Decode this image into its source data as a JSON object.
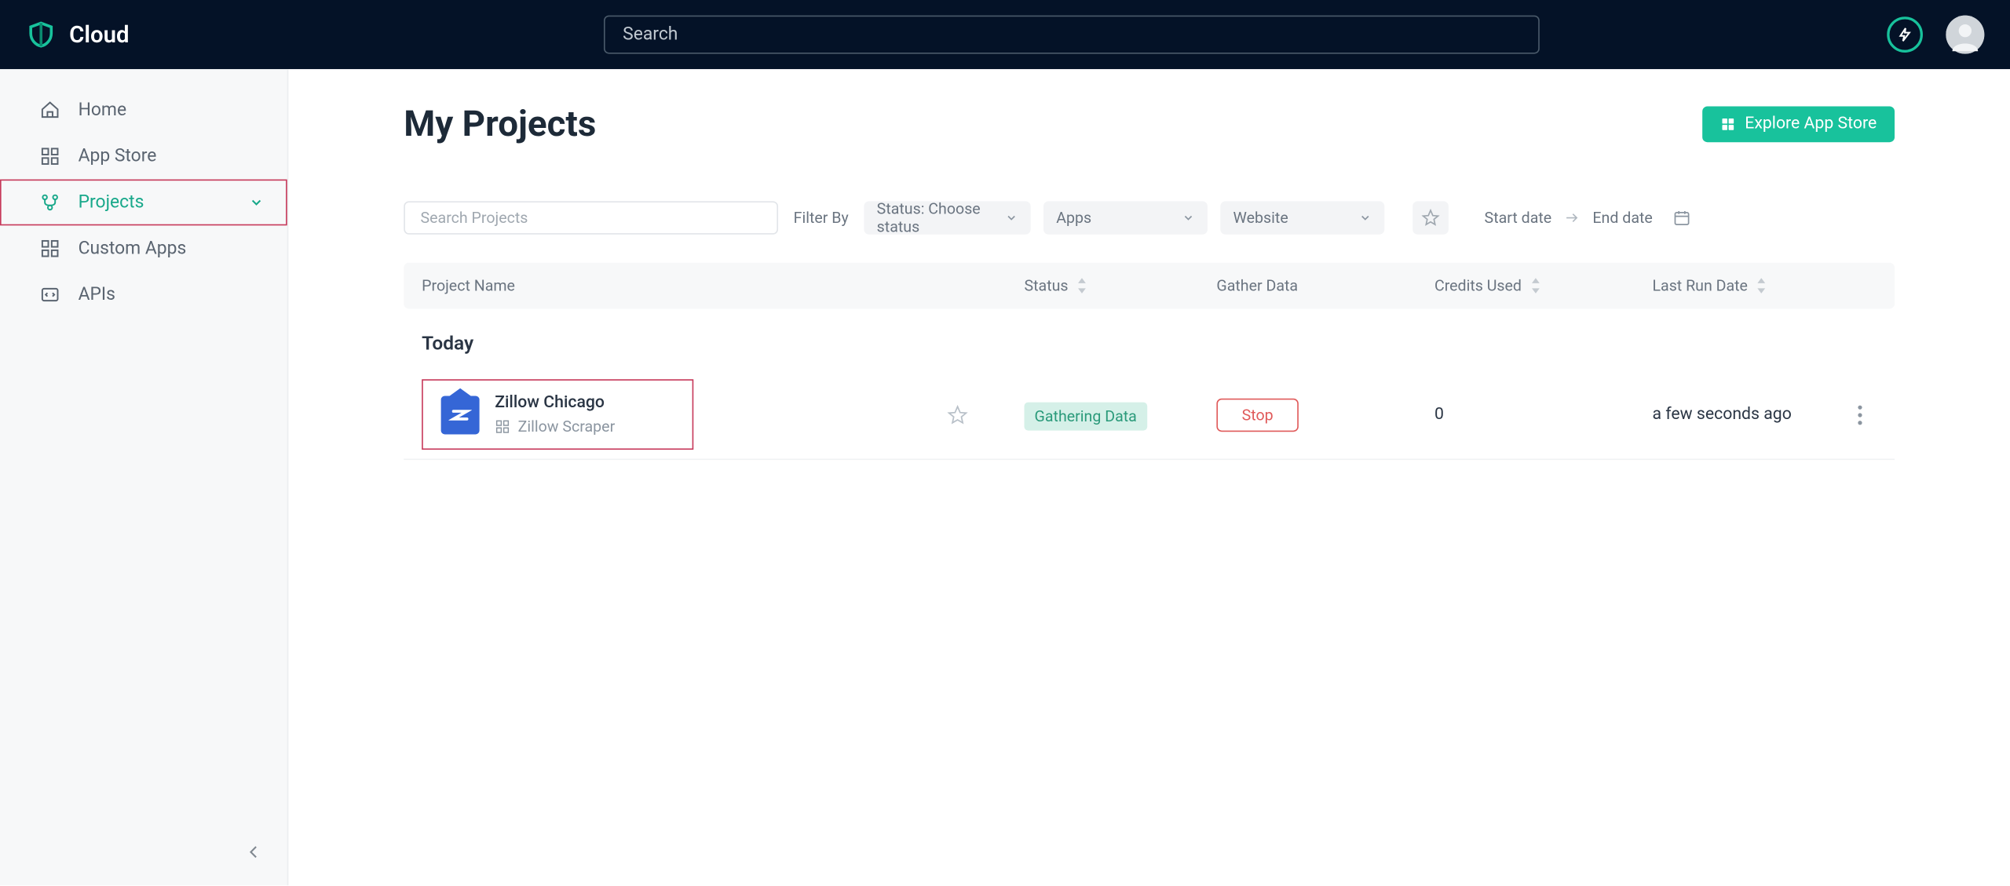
{
  "brand": "Cloud",
  "topbar": {
    "search_placeholder": "Search"
  },
  "sidebar": {
    "items": [
      {
        "label": "Home",
        "icon": "home"
      },
      {
        "label": "App Store",
        "icon": "grid"
      },
      {
        "label": "Projects",
        "icon": "flow",
        "active": true,
        "expandable": true
      },
      {
        "label": "Custom Apps",
        "icon": "grid"
      },
      {
        "label": "APIs",
        "icon": "code"
      }
    ]
  },
  "page": {
    "title": "My Projects",
    "explore_label": "Explore App Store"
  },
  "filters": {
    "search_placeholder": "Search Projects",
    "filter_by_label": "Filter By",
    "status_label": "Status: Choose status",
    "apps_label": "Apps",
    "website_label": "Website",
    "start_date_label": "Start date",
    "end_date_label": "End date"
  },
  "table": {
    "headers": {
      "name": "Project Name",
      "status": "Status",
      "gather": "Gather Data",
      "credits": "Credits Used",
      "last": "Last Run Date"
    },
    "section": "Today",
    "rows": [
      {
        "name": "Zillow Chicago",
        "type": "Zillow Scraper",
        "status": "Gathering Data",
        "action": "Stop",
        "credits": "0",
        "last": "a few seconds ago"
      }
    ]
  }
}
